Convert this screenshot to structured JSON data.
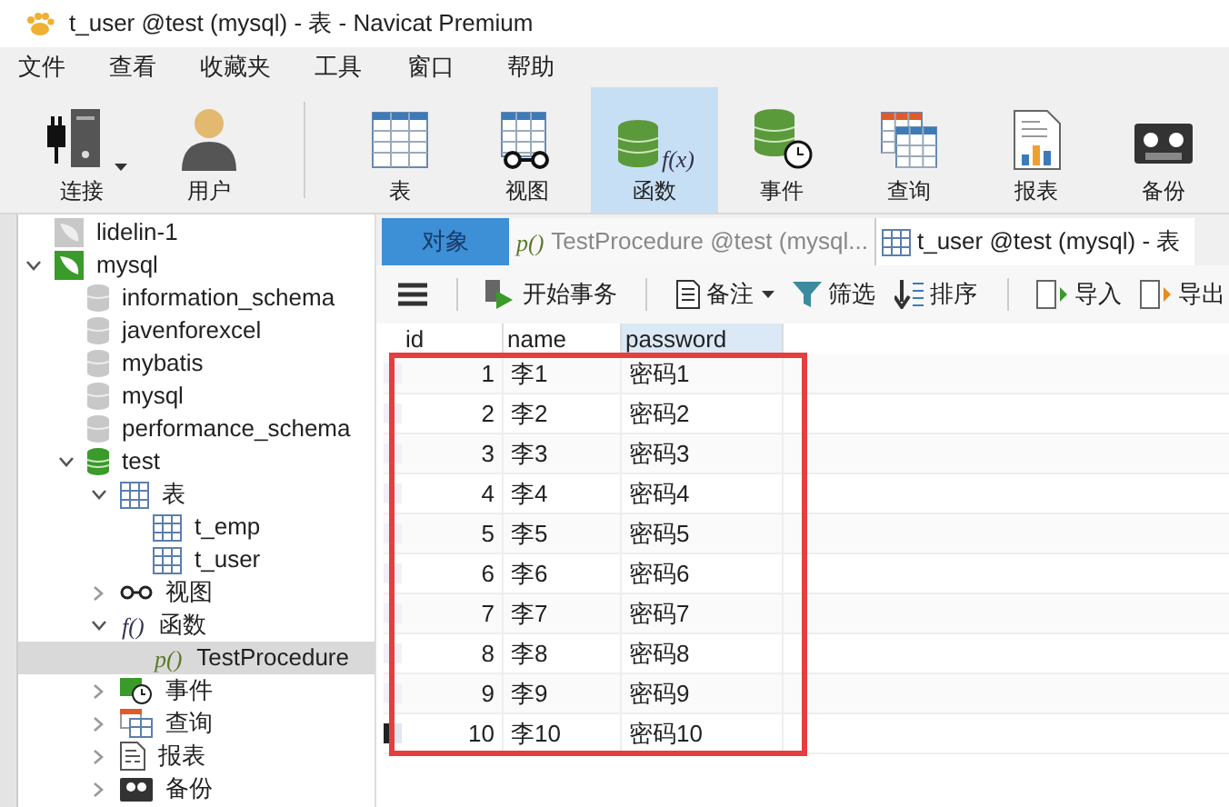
{
  "window": {
    "title": "t_user @test (mysql) - 表 - Navicat Premium"
  },
  "menu": [
    "文件",
    "查看",
    "收藏夹",
    "工具",
    "窗口",
    "帮助"
  ],
  "toolbar": [
    {
      "kind": "connect",
      "label": "连接",
      "selected": false
    },
    {
      "kind": "user",
      "label": "用户",
      "selected": false
    },
    {
      "kind": "table",
      "label": "表",
      "selected": false
    },
    {
      "kind": "view",
      "label": "视图",
      "selected": false
    },
    {
      "kind": "function",
      "label": "函数",
      "glyph": "f(x)",
      "selected": true
    },
    {
      "kind": "event",
      "label": "事件",
      "selected": false
    },
    {
      "kind": "query",
      "label": "查询",
      "selected": false
    },
    {
      "kind": "report",
      "label": "报表",
      "selected": false
    },
    {
      "kind": "backup",
      "label": "备份",
      "selected": false
    }
  ],
  "sidebar": {
    "items": [
      {
        "kind": "connection-closed",
        "label": "lidelin-1",
        "selected": false
      },
      {
        "kind": "connection",
        "label": "mysql",
        "expanded": true,
        "selected": false,
        "children": [
          {
            "kind": "db-closed",
            "label": "information_schema",
            "selected": false
          },
          {
            "kind": "db-closed",
            "label": "javenforexcel",
            "selected": false
          },
          {
            "kind": "db-closed",
            "label": "mybatis",
            "selected": false
          },
          {
            "kind": "db-closed",
            "label": "mysql",
            "selected": false
          },
          {
            "kind": "db-closed",
            "label": "performance_schema",
            "selected": false
          },
          {
            "kind": "db",
            "label": "test",
            "expanded": true,
            "selected": false,
            "children": [
              {
                "kind": "table",
                "label": "表",
                "expanded": true,
                "selected": false,
                "children": [
                  {
                    "kind": "table",
                    "label": "t_emp",
                    "selected": false
                  },
                  {
                    "kind": "table",
                    "label": "t_user",
                    "selected": false
                  }
                ]
              },
              {
                "kind": "view",
                "label": "视图",
                "expanded": false,
                "selected": false
              },
              {
                "kind": "function",
                "label": "函数",
                "glyph": "f()",
                "expanded": true,
                "selected": false,
                "children": [
                  {
                    "kind": "procedure",
                    "label": "TestProcedure",
                    "glyph": "p()",
                    "selected": true
                  }
                ]
              },
              {
                "kind": "event",
                "label": "事件",
                "expanded": false,
                "selected": false
              },
              {
                "kind": "query",
                "label": "查询",
                "expanded": false,
                "selected": false
              },
              {
                "kind": "report",
                "label": "报表",
                "expanded": false,
                "selected": false
              },
              {
                "kind": "backup",
                "label": "备份",
                "expanded": false,
                "selected": false
              }
            ]
          }
        ]
      }
    ]
  },
  "tabs": [
    {
      "kind": "object",
      "label": "对象",
      "selected": true
    },
    {
      "kind": "procedure",
      "glyph": "p()",
      "label": "TestProcedure @test (mysql...",
      "selected": false
    },
    {
      "kind": "table",
      "label": "t_user @test (mysql) - 表",
      "selected": true
    }
  ],
  "actions": [
    {
      "kind": "menu"
    },
    {
      "kind": "transaction",
      "label": "开始事务"
    },
    {
      "kind": "note",
      "label": "备注"
    },
    {
      "kind": "filter",
      "label": "筛选"
    },
    {
      "kind": "sort",
      "label": "排序"
    },
    {
      "kind": "import",
      "label": "导入"
    },
    {
      "kind": "export",
      "label": "导出"
    }
  ],
  "table": {
    "columns": [
      "id",
      "name",
      "password"
    ],
    "rows": [
      {
        "cells": [
          "1",
          "李1",
          "密码1"
        ],
        "current": false
      },
      {
        "cells": [
          "2",
          "李2",
          "密码2"
        ],
        "current": false
      },
      {
        "cells": [
          "3",
          "李3",
          "密码3"
        ],
        "current": false
      },
      {
        "cells": [
          "4",
          "李4",
          "密码4"
        ],
        "current": false
      },
      {
        "cells": [
          "5",
          "李5",
          "密码5"
        ],
        "current": false
      },
      {
        "cells": [
          "6",
          "李6",
          "密码6"
        ],
        "current": false
      },
      {
        "cells": [
          "7",
          "李7",
          "密码7"
        ],
        "current": false
      },
      {
        "cells": [
          "8",
          "李8",
          "密码8"
        ],
        "current": false
      },
      {
        "cells": [
          "9",
          "李9",
          "密码9"
        ],
        "current": false
      },
      {
        "cells": [
          "10",
          "李10",
          "密码10"
        ],
        "current": true
      }
    ]
  },
  "highlight": {
    "kind": "rectangle"
  }
}
